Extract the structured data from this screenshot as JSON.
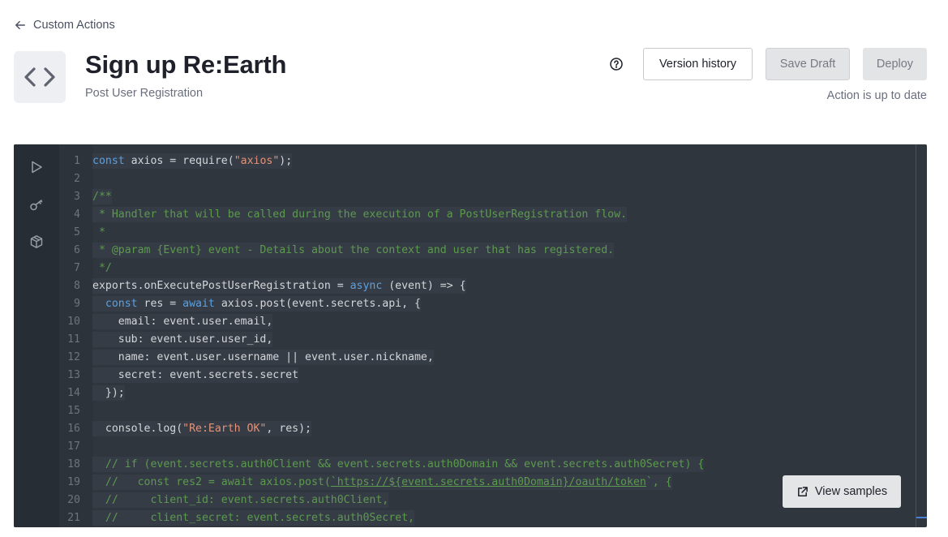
{
  "breadcrumb": {
    "back_label": "Custom Actions",
    "icon": "arrow-left-icon"
  },
  "header": {
    "title": "Sign up Re:Earth",
    "subtitle": "Post User Registration",
    "icon": "code-brackets-icon"
  },
  "toolbar": {
    "help_icon": "question-circle-icon",
    "version_history_label": "Version history",
    "save_draft_label": "Save Draft",
    "deploy_label": "Deploy",
    "status": "Action is up to date"
  },
  "editor": {
    "rail_icons": [
      "play-icon",
      "key-icon",
      "package-icon"
    ],
    "lines": [
      "1",
      "2",
      "3",
      "4",
      "5",
      "6",
      "7",
      "8",
      "9",
      "10",
      "11",
      "12",
      "13",
      "14",
      "15",
      "16",
      "17",
      "18",
      "19",
      "20",
      "21"
    ],
    "code": {
      "l1": [
        "const",
        " axios = require(",
        "\"axios\"",
        ");"
      ],
      "l3": "/**",
      "l4": " * Handler that will be called during the execution of a PostUserRegistration flow.",
      "l5": " *",
      "l6": " * @param {Event} event - Details about the context and user that has registered.",
      "l7": " */",
      "l8": [
        "exports.onExecutePostUserRegistration = ",
        "async",
        " (event) => {"
      ],
      "l9": [
        "  ",
        "const",
        " res = ",
        "await",
        " axios.post(event.secrets.api, {"
      ],
      "l10": "    email: event.user.email,",
      "l11": "    sub: event.user.user_id,",
      "l12": "    name: event.user.username || event.user.nickname,",
      "l13": "    secret: event.secrets.secret",
      "l14": "  });",
      "l16": [
        "  console.log(",
        "\"Re:Earth OK\"",
        ", res);"
      ],
      "l18": "  // if (event.secrets.auth0Client && event.secrets.auth0Domain && event.secrets.auth0Secret) {",
      "l19": [
        "  //   const res2 = await axios.post(",
        "`https://${event.secrets.auth0Domain}/oauth/token",
        "`, {"
      ],
      "l20": "  //     client_id: event.secrets.auth0Client,",
      "l21": "  //     client_secret: event.secrets.auth0Secret,"
    },
    "view_samples_label": "View samples",
    "view_samples_icon": "external-link-icon"
  }
}
